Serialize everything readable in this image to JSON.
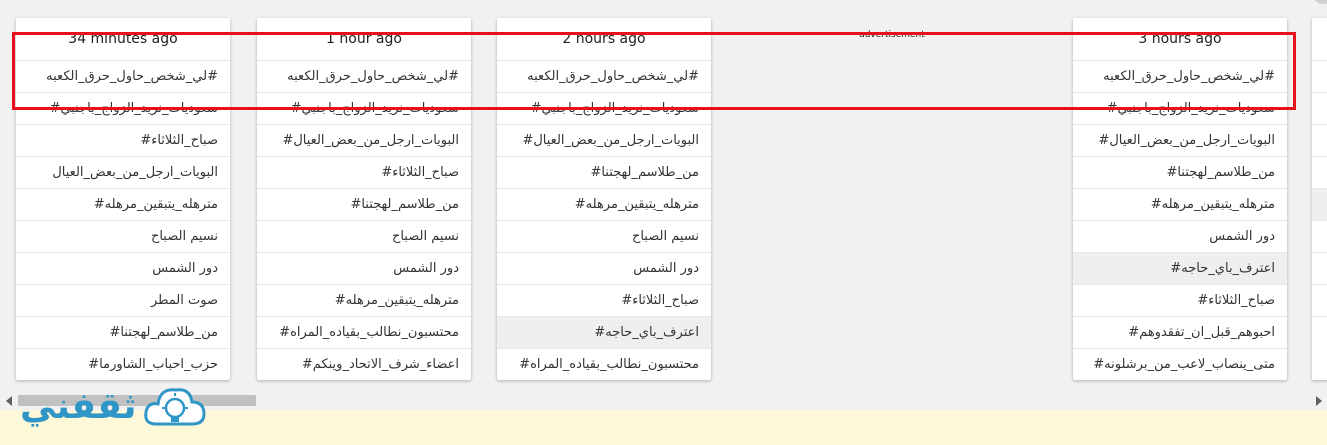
{
  "ad_label": "advertisement",
  "columns": [
    {
      "time": "34 minutes ago",
      "items": [
        "#لي_شخص_حاول_حرق_الكعبه",
        "سعوديات_نريد_الزواج_باجنبي#",
        "صباح_الثلاثاء#",
        "البويات_ارجل_من_بعض_العيال",
        "مترهله_يتبقين_مرهله#",
        "نسيم الصباح",
        "دور الشمس",
        "صوت المطر",
        "من_طلاسم_لهجتنا#",
        "حزب_احباب_الشاورما#"
      ],
      "highlighted": -1
    },
    {
      "time": "1 hour ago",
      "items": [
        "#لي_شخص_حاول_حرق_الكعبه",
        "سعوديات_نريد_الزواج_باجنبي#",
        "البويات_ارجل_من_بعض_العيال#",
        "صباح_الثلاثاء#",
        "من_طلاسم_لهجتنا#",
        "نسيم الصباح",
        "دور الشمس",
        "مترهله_يتبقين_مرهله#",
        "محتسبون_نطالب_بقياده_المراه#",
        "اعضاء_شرف_الاتحاد_وينكم#"
      ],
      "highlighted": -1
    },
    {
      "time": "2 hours ago",
      "items": [
        "#لي_شخص_حاول_حرق_الكعبه",
        "سعوديات_نريد_الزواج_باجنبي#",
        "البويات_ارجل_من_بعض_العيال#",
        "من_طلاسم_لهجتنا#",
        "مترهله_يتبقين_مرهله#",
        "نسيم الصباح",
        "دور الشمس",
        "صباح_الثلاثاء#",
        "اعترف_باي_حاجه#",
        "محتسبون_نطالب_بقياده_المراه#"
      ],
      "highlighted": 8
    },
    {
      "time": "3 hours ago",
      "items": [
        "#لي_شخص_حاول_حرق_الكعبه",
        "سعوديات_نريد_الزواج_باجنبي#",
        "البويات_ارجل_من_بعض_العيال#",
        "من_طلاسم_لهجتنا#",
        "مترهله_يتبقين_مرهله#",
        "دور الشمس",
        "اعترف_باي_حاجه#",
        "صباح_الثلاثاء#",
        "احبوهم_قبل_ان_تفقدوهم#",
        "متى_ينصاب_لاعب_من_برشلونه#"
      ],
      "highlighted": 6
    }
  ],
  "logo_text": "ثقفني",
  "colors": {
    "highlight_border": "#e8101c",
    "logo": "#2f96c7",
    "bottom_band": "#fdf9d8"
  },
  "icons": {
    "logo_icon": "lightbulb-cloud-icon",
    "scroll_left": "arrow-left-icon",
    "scroll_right": "arrow-right-icon"
  }
}
